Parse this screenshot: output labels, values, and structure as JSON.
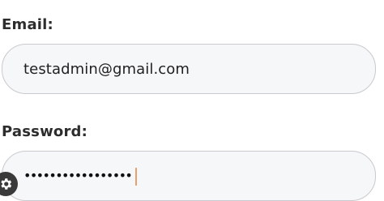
{
  "form": {
    "email": {
      "label": "Email:",
      "value": "testadmin@gmail.com"
    },
    "password": {
      "label": "Password:",
      "masked_value": "•••••••••••••••••"
    }
  },
  "icons": {
    "badge": "gear-icon"
  },
  "colors": {
    "field_border": "#c9c9cf",
    "field_background": "#f6f7f9",
    "caret": "#e8a070"
  }
}
